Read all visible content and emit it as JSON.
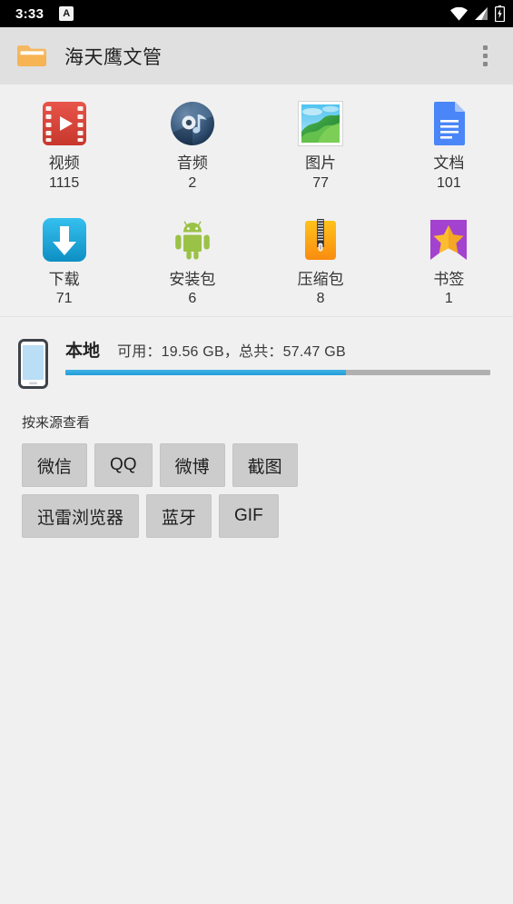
{
  "status_bar": {
    "time": "3:33",
    "ime_badge": "A",
    "icons": [
      "wifi-icon",
      "cellular-signal-icon",
      "battery-charging-icon"
    ]
  },
  "app_bar": {
    "title": "海天鹰文管",
    "folder_icon": "folder-icon",
    "overflow_icon": "overflow-menu-icon"
  },
  "categories": [
    {
      "icon": "video-icon",
      "label": "视频",
      "count": "1115"
    },
    {
      "icon": "audio-icon",
      "label": "音频",
      "count": "2"
    },
    {
      "icon": "image-icon",
      "label": "图片",
      "count": "77"
    },
    {
      "icon": "document-icon",
      "label": "文档",
      "count": "101"
    },
    {
      "icon": "download-icon",
      "label": "下载",
      "count": "71"
    },
    {
      "icon": "apk-icon",
      "label": "安装包",
      "count": "6"
    },
    {
      "icon": "archive-icon",
      "label": "压缩包",
      "count": "8"
    },
    {
      "icon": "bookmark-icon",
      "label": "书签",
      "count": "1"
    }
  ],
  "storage": {
    "icon": "phone-icon",
    "name": "本地",
    "detail": "可用：19.56 GB，总共：57.47 GB",
    "free_gb": 19.56,
    "total_gb": 57.47,
    "used_percent": 66,
    "fill_color": "#2aa7de",
    "track_color": "#b0b0b0"
  },
  "source_filter": {
    "label": "按来源查看",
    "rows": [
      [
        "微信",
        "QQ",
        "微博",
        "截图"
      ],
      [
        "迅雷浏览器",
        "蓝牙",
        "GIF"
      ]
    ]
  },
  "theme": {
    "background": "#f0f0f0",
    "appbar_background": "#e0e0e0",
    "statusbar_background": "#000000",
    "chip_background": "#cccccc",
    "text_primary": "#333333"
  }
}
